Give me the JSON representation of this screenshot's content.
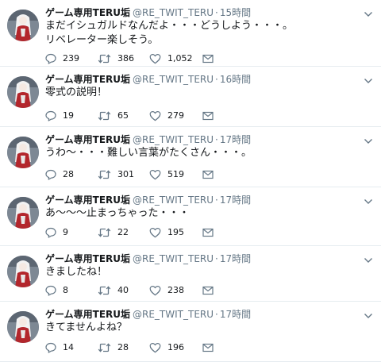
{
  "tweets": [
    {
      "name": "ゲーム専用TERU垢",
      "handle": "@RE_TWIT_TERU",
      "dot": "·",
      "time": "15時間",
      "text": "まだイシュガルドなんだよ・・・どうしよう・・・。\nリベレーター楽しそう。",
      "replies": "239",
      "retweets": "386",
      "likes": "1,052"
    },
    {
      "name": "ゲーム専用TERU垢",
      "handle": "@RE_TWIT_TERU",
      "dot": "·",
      "time": "16時間",
      "text": "零式の説明！",
      "replies": "19",
      "retweets": "65",
      "likes": "279"
    },
    {
      "name": "ゲーム専用TERU垢",
      "handle": "@RE_TWIT_TERU",
      "dot": "·",
      "time": "17時間",
      "text": "うわ～・・・難しい言葉がたくさん・・・。",
      "replies": "28",
      "retweets": "301",
      "likes": "519"
    },
    {
      "name": "ゲーム専用TERU垢",
      "handle": "@RE_TWIT_TERU",
      "dot": "·",
      "time": "17時間",
      "text": "あ～～～止まっちゃった・・・",
      "replies": "9",
      "retweets": "22",
      "likes": "195"
    },
    {
      "name": "ゲーム専用TERU垢",
      "handle": "@RE_TWIT_TERU",
      "dot": "·",
      "time": "17時間",
      "text": "きましたね！",
      "replies": "8",
      "retweets": "40",
      "likes": "238"
    },
    {
      "name": "ゲーム専用TERU垢",
      "handle": "@RE_TWIT_TERU",
      "dot": "·",
      "time": "17時間",
      "text": "きてませんよね？",
      "replies": "14",
      "retweets": "28",
      "likes": "196"
    }
  ],
  "icons": {
    "reply": "reply-icon",
    "retweet": "retweet-icon",
    "like": "heart-icon",
    "dm": "envelope-icon",
    "menu": "chevron-down-icon"
  },
  "colors": {
    "text": "#14171a",
    "secondary": "#657786",
    "divider": "#e6ecf0"
  }
}
